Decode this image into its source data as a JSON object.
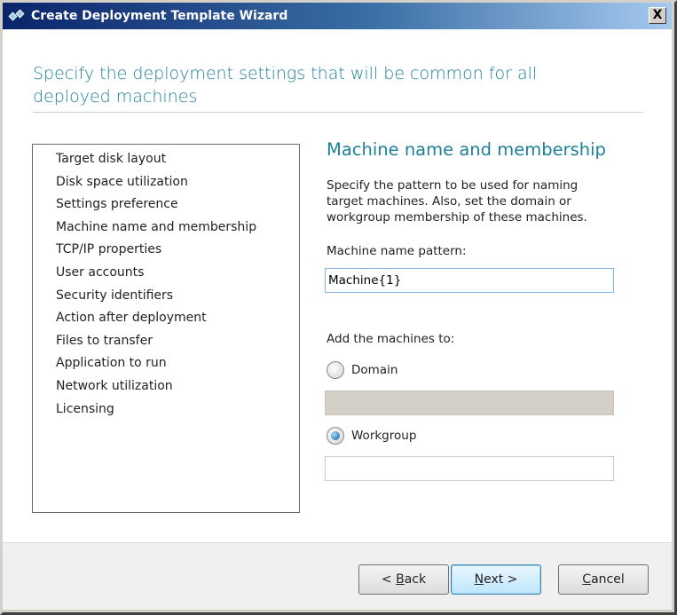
{
  "window": {
    "title": "Create Deployment Template Wizard",
    "close_label": "X"
  },
  "heading": "Specify the deployment settings that will be common for all deployed machines",
  "steps": [
    "Target disk layout",
    "Disk space utilization",
    "Settings preference",
    "Machine name and membership",
    "TCP/IP properties",
    "User accounts",
    "Security identifiers",
    "Action after deployment",
    "Files to transfer",
    "Application to run",
    "Network utilization",
    "Licensing"
  ],
  "panel": {
    "title": "Machine name and membership",
    "description": "Specify the pattern to be used for naming target machines. Also, set the domain or workgroup membership of these machines.",
    "name_label": "Machine name pattern:",
    "name_value": "Machine{1}",
    "add_label": "Add the machines to:",
    "domain_label": "Domain",
    "domain_value": "",
    "workgroup_label": "Workgroup",
    "workgroup_value": "",
    "selected": "Workgroup"
  },
  "buttons": {
    "back_prefix": "< ",
    "back_key": "B",
    "back_rest": "ack",
    "next_key": "N",
    "next_rest": "ext >",
    "cancel_key": "C",
    "cancel_rest": "ancel"
  }
}
